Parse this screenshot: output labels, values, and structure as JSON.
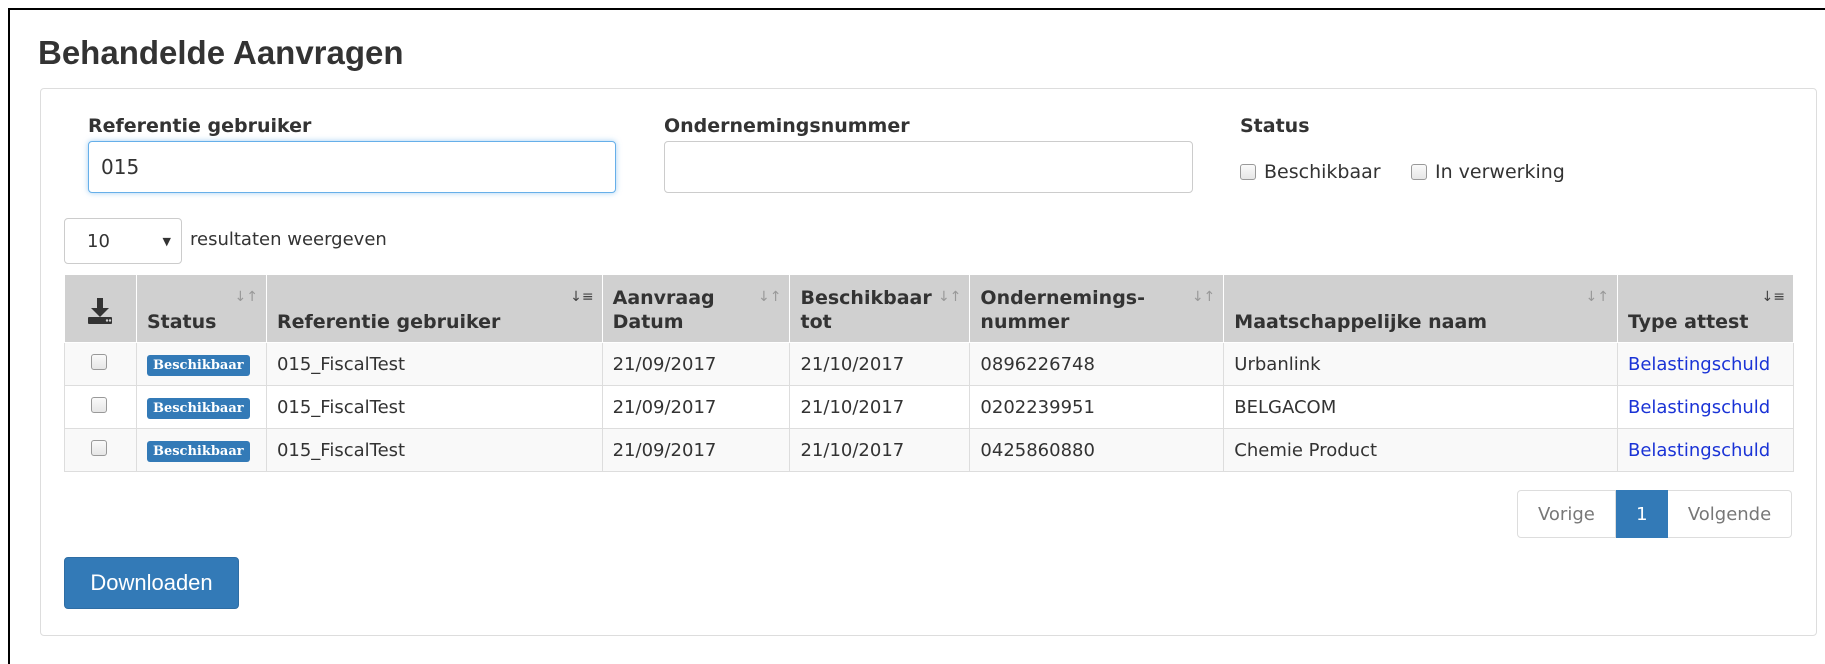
{
  "page_title": "Behandelde Aanvragen",
  "filters": {
    "referentie_label": "Referentie gebruiker",
    "referentie_value": "015",
    "ondernemings_label": "Ondernemingsnummer",
    "ondernemings_value": "",
    "status_label": "Status",
    "status_options": [
      {
        "label": "Beschikbaar",
        "checked": false
      },
      {
        "label": "In verwerking",
        "checked": false
      }
    ]
  },
  "length": {
    "selected": "10",
    "suffix": "resultaten weergeven"
  },
  "table": {
    "columns": [
      {
        "label": "",
        "icon": "download-icon"
      },
      {
        "label": "Status"
      },
      {
        "label": "Referentie gebruiker"
      },
      {
        "label": "Aanvraag Datum"
      },
      {
        "label": "Beschikbaar tot"
      },
      {
        "label": "Ondernemings- nummer"
      },
      {
        "label": "Maatschappelijke naam"
      },
      {
        "label": "Type attest"
      }
    ],
    "rows": [
      {
        "status": "Beschikbaar",
        "referentie": "015_FiscalTest",
        "aanvraag_datum": "21/09/2017",
        "beschikbaar_tot": "21/10/2017",
        "ondernemingsnummer": "0896226748",
        "naam": "Urbanlink",
        "type_attest": "Belastingschuld"
      },
      {
        "status": "Beschikbaar",
        "referentie": "015_FiscalTest",
        "aanvraag_datum": "21/09/2017",
        "beschikbaar_tot": "21/10/2017",
        "ondernemingsnummer": "0202239951",
        "naam": "BELGACOM",
        "type_attest": "Belastingschuld"
      },
      {
        "status": "Beschikbaar",
        "referentie": "015_FiscalTest",
        "aanvraag_datum": "21/09/2017",
        "beschikbaar_tot": "21/10/2017",
        "ondernemingsnummer": "0425860880",
        "naam": "Chemie Product",
        "type_attest": "Belastingschuld"
      }
    ]
  },
  "pagination": {
    "prev": "Vorige",
    "current": "1",
    "next": "Volgende"
  },
  "download_button": "Downloaden",
  "colors": {
    "primary": "#337ab7",
    "link": "#1a33d6",
    "header_bg": "#d0d0d0"
  }
}
